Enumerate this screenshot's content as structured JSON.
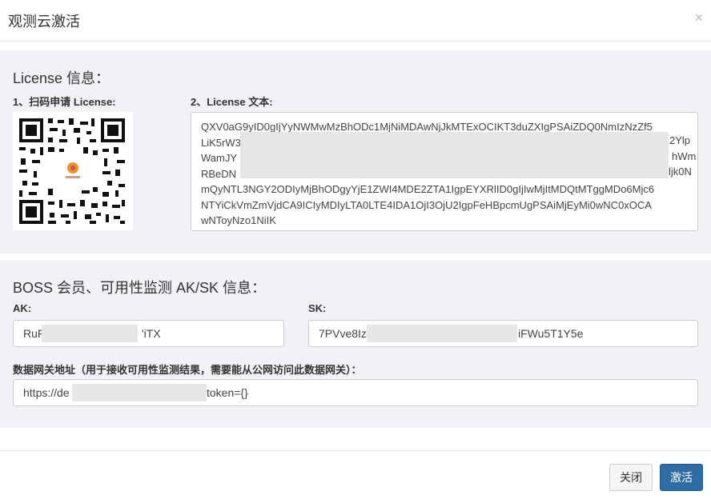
{
  "modal": {
    "title": "观测云激活",
    "close_icon": "×"
  },
  "license": {
    "section_title": "License 信息：",
    "step1_label": "1、扫码申请 License:",
    "step2_label": "2、License 文本:",
    "text_lines": [
      "QXV0aG9yID0gIjYyNWMwMzBhODc1MjNiMDAwNjJkMTExOCIKT3duZXIgPSAiZDQ0NmIzNzZf5",
      "LiK5rW3",
      "WamJY",
      "RBeDN",
      "mQyNTL3NGY2ODIyMjBhODgyYjE1ZWI4MDE2ZTA1IgpEYXRlID0gIjIwMjItMDQtMTggMDo6Mjc6",
      "NTYiCkVmZmVjdCA9ICIyMDIyLTA0LTE4IDA1OjI3OjU2IgpFeHBpcmUgPSAiMjEyMi0wNC0xOCA",
      "wNToyNzo1NiIK"
    ],
    "text_right_fragments": [
      "2Ylp",
      "hWm",
      "ljk0N"
    ]
  },
  "boss": {
    "section_title": "BOSS 会员、可用性监测 AK/SK 信息：",
    "ak_label": "AK:",
    "ak_prefix": "RuF",
    "ak_suffix": "'iTX",
    "sk_label": "SK:",
    "sk_prefix": "7PVve8Iz",
    "sk_suffix": "iFWu5T1Y5e",
    "gateway_label": "数据网关地址（用于接收可用性监测结果，需要能从公网访问此数据网关）：",
    "gateway_prefix": "https://de",
    "gateway_suffix": "token={}"
  },
  "footer": {
    "close_label": "关闭",
    "activate_label": "激活"
  },
  "colors": {
    "primary": "#2e6da4",
    "panel_bg": "#f2f2f6",
    "redact": "#e6e6e6"
  }
}
